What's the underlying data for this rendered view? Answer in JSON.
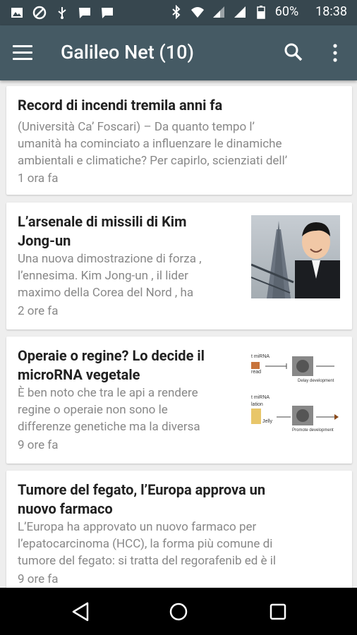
{
  "status_bar": {
    "battery": "60%",
    "time": "18:38",
    "icons": [
      "image-icon",
      "blocked-icon",
      "usb-icon",
      "chat-icon",
      "chat-icon",
      "bluetooth-icon",
      "wifi-icon",
      "signal-icon",
      "signal-icon",
      "battery-icon"
    ]
  },
  "app_bar": {
    "title": "Galileo Net (10)",
    "icons": [
      "menu-icon",
      "search-icon",
      "more-vert-icon"
    ],
    "color": "#455a64"
  },
  "articles": [
    {
      "title": "Record di incendi tremila anni fa",
      "excerpt": [
        "(Università Ca’ Foscari) – Da quanto tempo l’",
        "umanità ha cominciato a influenzare le dinamiche",
        "ambientali e climatiche? Per capirlo, scienziati dell’"
      ],
      "time": "1 ora fa"
    },
    {
      "title_lines": [
        "L’arsenale di missili di Kim",
        "Jong-un"
      ],
      "excerpt": [
        "Una nuova dimostrazione di forza ,",
        "l’ennesima. Kim Jong-un , il lider",
        "maximo della Corea del Nord , ha"
      ],
      "time": "2 ore fa",
      "thumbnail": "kim-jong-un-missile-photo"
    },
    {
      "title_lines": [
        "Operaie o regine? Lo decide il",
        "microRNA vegetale"
      ],
      "excerpt": [
        "È ben noto che tra le api a rendere",
        "regine o operaie non sono le",
        "differenze genetiche ma la diversa"
      ],
      "time": "9 ore fa",
      "thumbnail": "microrna-diagram",
      "thumb_labels": [
        "t miRNA",
        "read",
        "Delay development",
        "t miRNA",
        "lation",
        "Jelly",
        "Promote development"
      ]
    },
    {
      "title_lines": [
        "Tumore del fegato, l’Europa approva un",
        "nuovo farmaco"
      ],
      "excerpt": [
        "L’Europa ha approvato un nuovo farmaco per",
        "l’epatocarcinoma (HCC), la forma più comune di",
        "tumore del fegato: si tratta del regorafenib ed è il"
      ],
      "time": "9 ore fa"
    }
  ],
  "nav_bar": {
    "icons": [
      "back-icon",
      "home-icon",
      "recents-icon"
    ]
  }
}
